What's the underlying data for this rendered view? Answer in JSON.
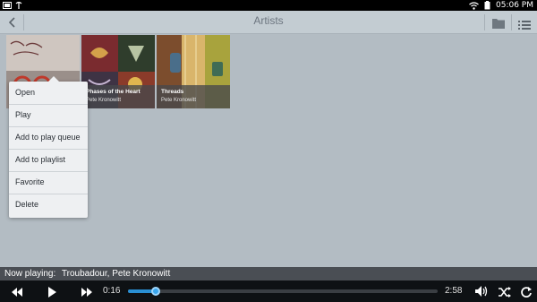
{
  "status_bar": {
    "icons_left": [
      "notification-icon",
      "signal-icon"
    ],
    "icons_right": [
      "wifi-icon",
      "battery-icon"
    ],
    "time": "05:06 PM"
  },
  "action_bar": {
    "title": "Artists",
    "back_icon": "chevron-left-icon",
    "folder_icon": "folder-icon",
    "menu_icon": "list-icon"
  },
  "albums": [
    {
      "title": "",
      "artist": ""
    },
    {
      "title": "Phases of the Heart",
      "artist": "Pete Kronowitt"
    },
    {
      "title": "Threads",
      "artist": "Pete Kronowitt"
    }
  ],
  "context_menu": {
    "items": [
      "Open",
      "Play",
      "Add to play queue",
      "Add to playlist",
      "Favorite",
      "Delete"
    ]
  },
  "now_playing": {
    "label": "Now playing:",
    "track": "Troubadour, Pete Kronowitt"
  },
  "player": {
    "elapsed": "0:16",
    "duration": "2:58",
    "progress_fraction": 0.09,
    "colors": {
      "accent": "#2a8fd3"
    }
  }
}
